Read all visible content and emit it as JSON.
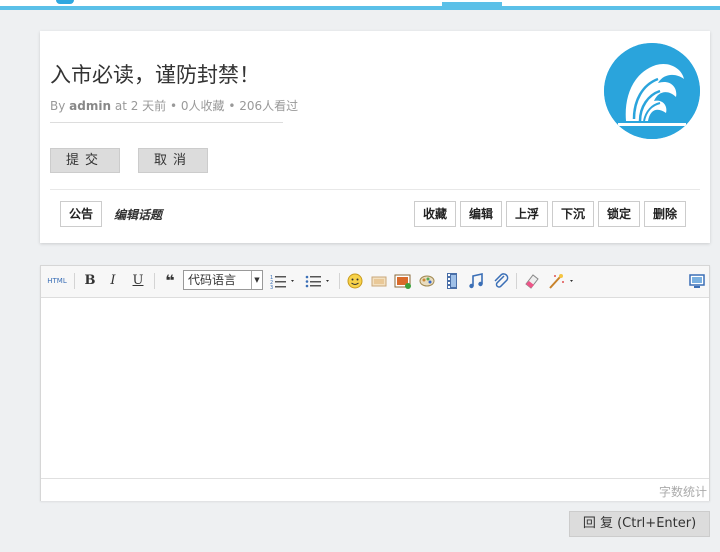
{
  "topic": {
    "title": "入市必读，谨防封禁！",
    "meta_by": "By",
    "author": "admin",
    "meta_rest": "at 2 天前 • 0人收藏 • 206人看过"
  },
  "form": {
    "submit_label": "提交",
    "cancel_label": "取消"
  },
  "tags": {
    "tag_label": "公告",
    "edit_topic_label": "编辑话题"
  },
  "actions": [
    {
      "label": "收藏",
      "name": "favorite-button"
    },
    {
      "label": "编辑",
      "name": "edit-button"
    },
    {
      "label": "上浮",
      "name": "float-up-button"
    },
    {
      "label": "下沉",
      "name": "sink-button"
    },
    {
      "label": "锁定",
      "name": "lock-button"
    },
    {
      "label": "删除",
      "name": "delete-button"
    }
  ],
  "toolbar": {
    "html_label": "HTML",
    "bold": "B",
    "italic": "I",
    "underline": "U",
    "quote": "❝",
    "code_language": "代码语言"
  },
  "editor": {
    "word_count_label": "字数统计"
  },
  "reply": {
    "label": "回 复 (Ctrl+Enter)"
  },
  "colors": {
    "accent": "#5bc0e8",
    "avatar": "#2aa4dc",
    "button_gray": "#dcdcdc"
  }
}
